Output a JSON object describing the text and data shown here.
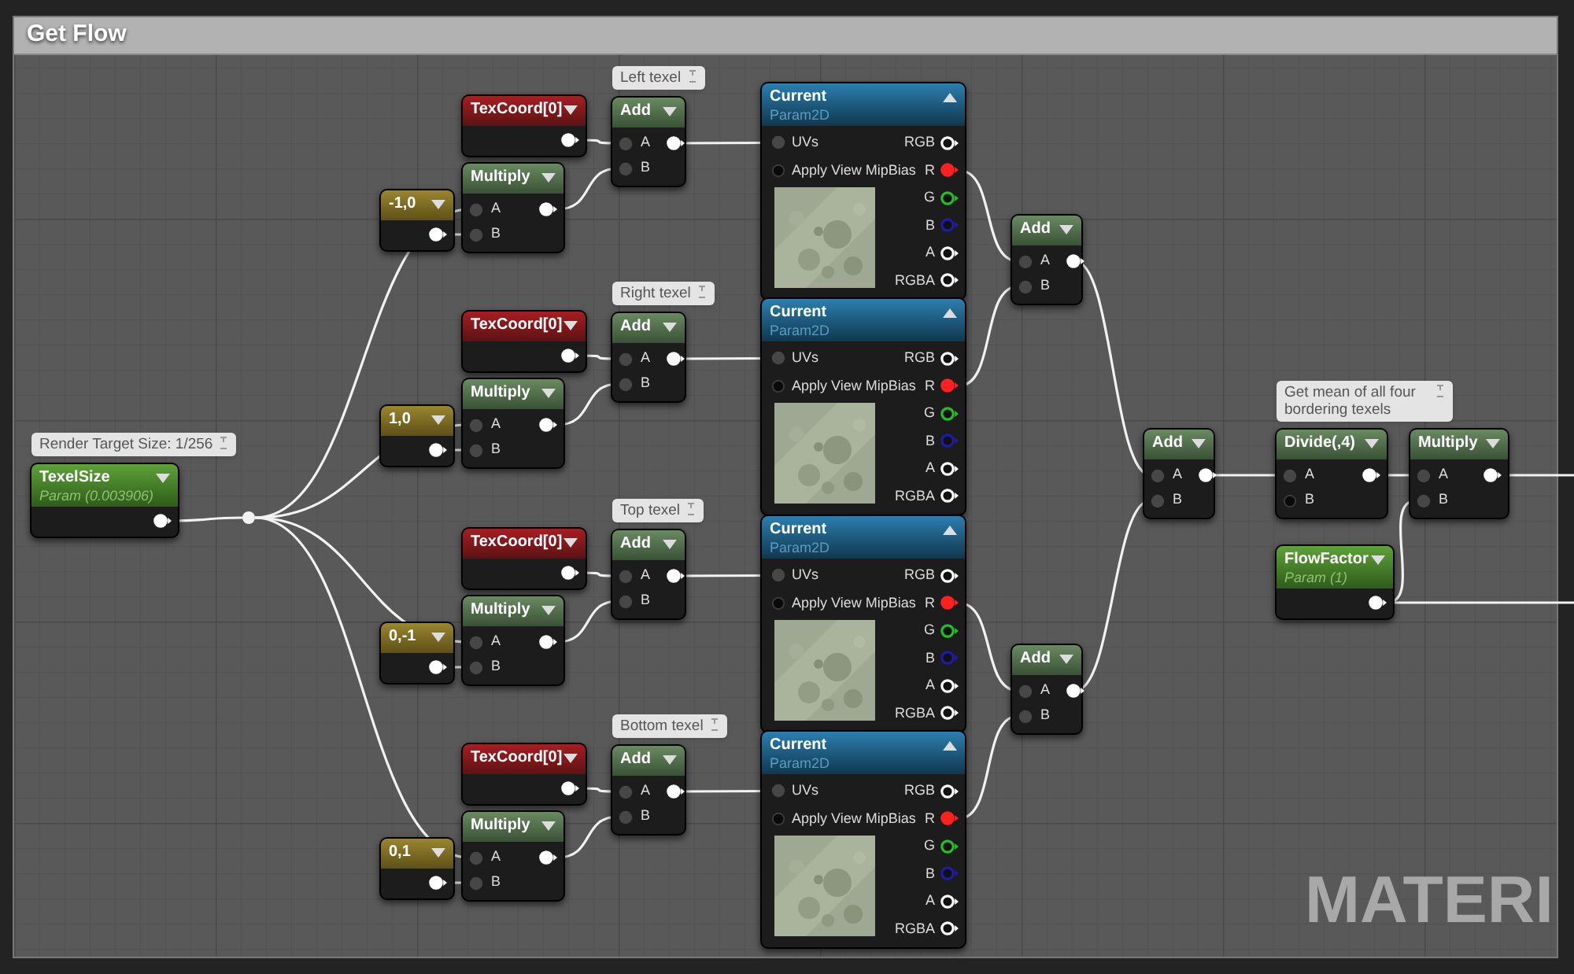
{
  "comment_box": {
    "title": "Get Flow"
  },
  "graph_label": "MATERI",
  "nodes": [
    {
      "kind": "param",
      "title": "TexelSize",
      "subtitle": "Param (0.003906)",
      "comment": "Render Target Size: 1/256",
      "outputs": [
        {
          "connected": true
        }
      ]
    },
    {
      "kind": "constant",
      "title": "-1,0",
      "outputs": [
        {
          "connected": true
        }
      ]
    },
    {
      "kind": "texcoord",
      "title": "TexCoord[0]",
      "outputs": [
        {
          "connected": true
        }
      ]
    },
    {
      "kind": "math",
      "title": "Multiply",
      "inputs": [
        {
          "label": "A",
          "connected": true
        },
        {
          "label": "B",
          "connected": true
        }
      ],
      "outputs": [
        {
          "connected": true
        }
      ]
    },
    {
      "kind": "math",
      "title": "Add",
      "comment": "Left texel",
      "inputs": [
        {
          "label": "A",
          "connected": true
        },
        {
          "label": "B",
          "connected": true
        }
      ],
      "outputs": [
        {
          "connected": true
        }
      ]
    },
    {
      "kind": "texture",
      "title": "Current",
      "subtitle": "Param2D",
      "inputs": [
        {
          "label": "UVs",
          "connected": true
        },
        {
          "label": "Apply View MipBias",
          "connected": false
        }
      ],
      "outputs": [
        {
          "label": "RGB",
          "color": "#ffffff",
          "connected": false
        },
        {
          "label": "R",
          "color": "#ff2020",
          "connected": true
        },
        {
          "label": "G",
          "color": "#22c022",
          "connected": false
        },
        {
          "label": "B",
          "color": "#1c1ca8",
          "connected": false
        },
        {
          "label": "A",
          "color": "#ffffff",
          "connected": false
        },
        {
          "label": "RGBA",
          "color": "#ffffff",
          "connected": false
        }
      ]
    },
    {
      "kind": "constant",
      "title": "1,0",
      "outputs": [
        {
          "connected": true
        }
      ]
    },
    {
      "kind": "texcoord",
      "title": "TexCoord[0]",
      "outputs": [
        {
          "connected": true
        }
      ]
    },
    {
      "kind": "math",
      "title": "Multiply",
      "inputs": [
        {
          "label": "A",
          "connected": true
        },
        {
          "label": "B",
          "connected": true
        }
      ],
      "outputs": [
        {
          "connected": true
        }
      ]
    },
    {
      "kind": "math",
      "title": "Add",
      "comment": "Right texel",
      "inputs": [
        {
          "label": "A",
          "connected": true
        },
        {
          "label": "B",
          "connected": true
        }
      ],
      "outputs": [
        {
          "connected": true
        }
      ]
    },
    {
      "kind": "texture",
      "title": "Current",
      "subtitle": "Param2D",
      "inputs": [
        {
          "label": "UVs",
          "connected": true
        },
        {
          "label": "Apply View MipBias",
          "connected": false
        }
      ],
      "outputs": [
        {
          "label": "RGB",
          "color": "#ffffff",
          "connected": false
        },
        {
          "label": "R",
          "color": "#ff2020",
          "connected": true
        },
        {
          "label": "G",
          "color": "#22c022",
          "connected": false
        },
        {
          "label": "B",
          "color": "#1c1ca8",
          "connected": false
        },
        {
          "label": "A",
          "color": "#ffffff",
          "connected": false
        },
        {
          "label": "RGBA",
          "color": "#ffffff",
          "connected": false
        }
      ]
    },
    {
      "kind": "constant",
      "title": "0,-1",
      "outputs": [
        {
          "connected": true
        }
      ]
    },
    {
      "kind": "texcoord",
      "title": "TexCoord[0]",
      "outputs": [
        {
          "connected": true
        }
      ]
    },
    {
      "kind": "math",
      "title": "Multiply",
      "inputs": [
        {
          "label": "A",
          "connected": true
        },
        {
          "label": "B",
          "connected": true
        }
      ],
      "outputs": [
        {
          "connected": true
        }
      ]
    },
    {
      "kind": "math",
      "title": "Add",
      "comment": "Top texel",
      "inputs": [
        {
          "label": "A",
          "connected": true
        },
        {
          "label": "B",
          "connected": true
        }
      ],
      "outputs": [
        {
          "connected": true
        }
      ]
    },
    {
      "kind": "texture",
      "title": "Current",
      "subtitle": "Param2D",
      "inputs": [
        {
          "label": "UVs",
          "connected": true
        },
        {
          "label": "Apply View MipBias",
          "connected": false
        }
      ],
      "outputs": [
        {
          "label": "RGB",
          "color": "#ffffff",
          "connected": false
        },
        {
          "label": "R",
          "color": "#ff2020",
          "connected": true
        },
        {
          "label": "G",
          "color": "#22c022",
          "connected": false
        },
        {
          "label": "B",
          "color": "#1c1ca8",
          "connected": false
        },
        {
          "label": "A",
          "color": "#ffffff",
          "connected": false
        },
        {
          "label": "RGBA",
          "color": "#ffffff",
          "connected": false
        }
      ]
    },
    {
      "kind": "constant",
      "title": "0,1",
      "outputs": [
        {
          "connected": true
        }
      ]
    },
    {
      "kind": "texcoord",
      "title": "TexCoord[0]",
      "outputs": [
        {
          "connected": true
        }
      ]
    },
    {
      "kind": "math",
      "title": "Multiply",
      "inputs": [
        {
          "label": "A",
          "connected": true
        },
        {
          "label": "B",
          "connected": true
        }
      ],
      "outputs": [
        {
          "connected": true
        }
      ]
    },
    {
      "kind": "math",
      "title": "Add",
      "comment": "Bottom texel",
      "inputs": [
        {
          "label": "A",
          "connected": true
        },
        {
          "label": "B",
          "connected": true
        }
      ],
      "outputs": [
        {
          "connected": true
        }
      ]
    },
    {
      "kind": "texture",
      "title": "Current",
      "subtitle": "Param2D",
      "inputs": [
        {
          "label": "UVs",
          "connected": true
        },
        {
          "label": "Apply View MipBias",
          "connected": false
        }
      ],
      "outputs": [
        {
          "label": "RGB",
          "color": "#ffffff",
          "connected": false
        },
        {
          "label": "R",
          "color": "#ff2020",
          "connected": true
        },
        {
          "label": "G",
          "color": "#22c022",
          "connected": false
        },
        {
          "label": "B",
          "color": "#1c1ca8",
          "connected": false
        },
        {
          "label": "A",
          "color": "#ffffff",
          "connected": false
        },
        {
          "label": "RGBA",
          "color": "#ffffff",
          "connected": false
        }
      ]
    },
    {
      "kind": "math",
      "title": "Add",
      "inputs": [
        {
          "label": "A",
          "connected": true
        },
        {
          "label": "B",
          "connected": true
        }
      ],
      "outputs": [
        {
          "connected": true
        }
      ]
    },
    {
      "kind": "math",
      "title": "Add",
      "inputs": [
        {
          "label": "A",
          "connected": true
        },
        {
          "label": "B",
          "connected": true
        }
      ],
      "outputs": [
        {
          "connected": true
        }
      ]
    },
    {
      "kind": "math",
      "title": "Add",
      "inputs": [
        {
          "label": "A",
          "connected": true
        },
        {
          "label": "B",
          "connected": true
        }
      ],
      "outputs": [
        {
          "connected": true
        }
      ]
    },
    {
      "kind": "math",
      "title": "Divide(,4)",
      "comment": "Get mean of all four bordering texels",
      "inputs": [
        {
          "label": "A",
          "connected": true
        },
        {
          "label": "B",
          "connected": false
        }
      ],
      "outputs": [
        {
          "connected": true
        }
      ]
    },
    {
      "kind": "param",
      "title": "FlowFactor",
      "subtitle": "Param (1)",
      "outputs": [
        {
          "connected": true
        }
      ]
    },
    {
      "kind": "math",
      "title": "Multiply",
      "inputs": [
        {
          "label": "A",
          "connected": true
        },
        {
          "label": "B",
          "connected": true
        }
      ],
      "outputs": [
        {
          "connected": true
        }
      ]
    }
  ]
}
